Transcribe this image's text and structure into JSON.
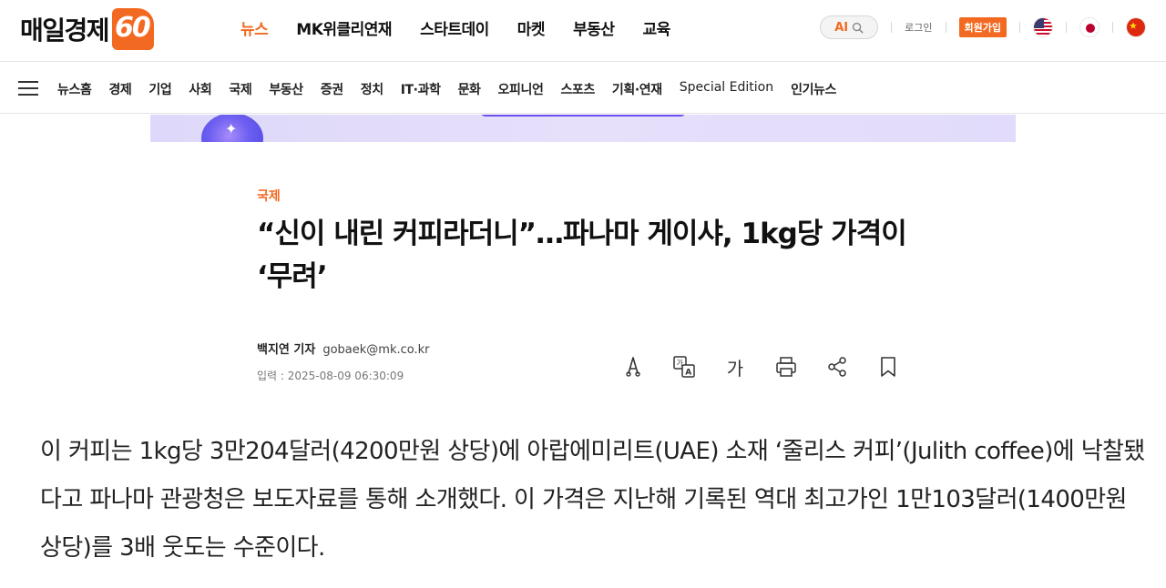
{
  "header": {
    "logo_text": "매일경제",
    "logo_badge": "60",
    "main_nav": [
      "뉴스",
      "MK위클리연재",
      "스타트데이",
      "마켓",
      "부동산",
      "교육"
    ],
    "active_index": 0,
    "ai_search_label": "AI",
    "login_label": "로그인",
    "join_label": "회원가입",
    "flags": [
      "us-flag-icon",
      "japan-flag-icon",
      "china-flag-icon"
    ]
  },
  "section_nav": [
    "뉴스홈",
    "경제",
    "기업",
    "사회",
    "국제",
    "부동산",
    "증권",
    "정치",
    "IT·과학",
    "문화",
    "오피니언",
    "스포츠",
    "기획·연재",
    "Special Edition",
    "인기뉴스"
  ],
  "article": {
    "category": "국제",
    "headline": "“신이 내린 커피라더니”…파나마 게이샤, 1kg당 가격이 ‘무려’",
    "author": "백지연 기자",
    "email": "gobaek@mk.co.kr",
    "published": "입력 : 2025-08-09 06:30:09",
    "font_size_glyph": "가",
    "body": "이 커피는 1kg당 3만204달러(4200만원 상당)에 아랍에미리트(UAE) 소재 ‘줄리스 커피’(Julith coffee)에 낙찰됐다고 파나마 관광청은 보도자료를 통해 소개했다. 이 가격은 지난해 기록된 역대 최고가인 1만103달러(1400만원 상당)를 3배 웃도는 수준이다."
  },
  "colors": {
    "accent": "#f26a21",
    "banner": "#e2dbfb"
  }
}
